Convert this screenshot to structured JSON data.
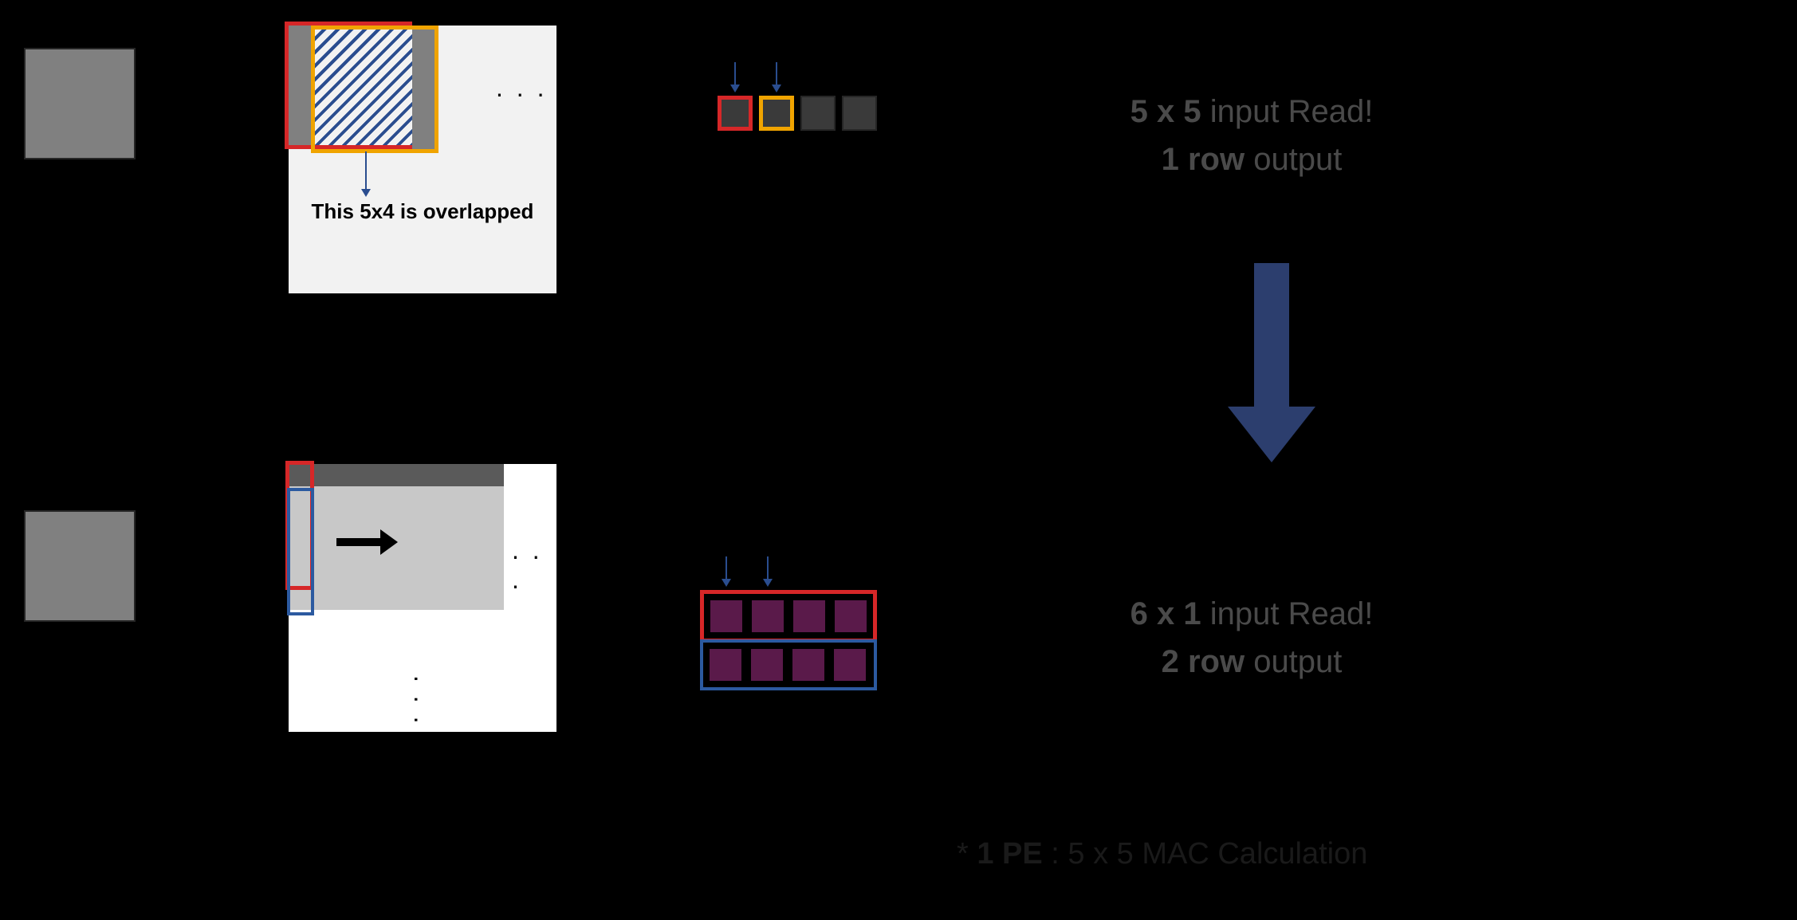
{
  "top": {
    "overlap_label": "This 5x4 is overlapped",
    "ellipsis_h": ". . .",
    "text_line1_bold": "5 x 5",
    "text_line1_rest": " input Read!",
    "text_line2_bold": "1 row",
    "text_line2_rest": " output"
  },
  "bottom": {
    "ellipsis_h": ". . .",
    "ellipsis_v": ". . .",
    "text_line1_bold": "6 x 1",
    "text_line1_rest": " input Read!",
    "text_line2_bold": "2 row",
    "text_line2_rest": " output"
  },
  "footnote": {
    "prefix": "* ",
    "bold": "1 PE",
    "rest": " : 5 x 5 MAC Calculation"
  }
}
